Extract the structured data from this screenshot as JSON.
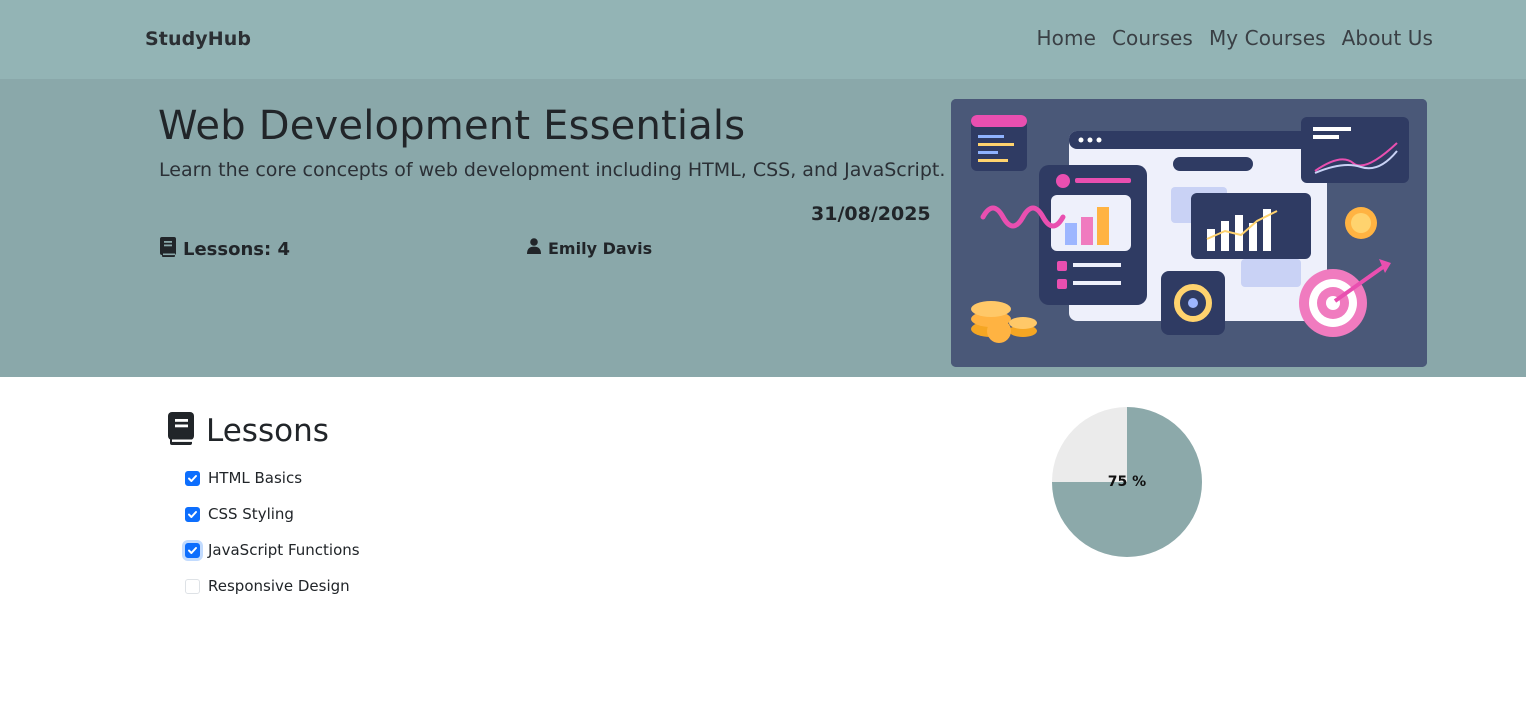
{
  "nav": {
    "brand": "StudyHub",
    "links": [
      "Home",
      "Courses",
      "My Courses",
      "About Us"
    ]
  },
  "course": {
    "title": "Web Development Essentials",
    "description": "Learn the core concepts of web development including HTML, CSS, and JavaScript.",
    "date": "31/08/2025",
    "lessons_label": "Lessons: 4",
    "author": "Emily Davis"
  },
  "lessons": {
    "heading": "Lessons",
    "items": [
      {
        "label": "HTML Basics",
        "checked": true
      },
      {
        "label": "CSS Styling",
        "checked": true
      },
      {
        "label": "JavaScript Functions",
        "checked": true
      },
      {
        "label": "Responsive Design",
        "checked": false
      }
    ]
  },
  "progress": {
    "percent": 75,
    "label": "75 %"
  },
  "colors": {
    "navbar": "#93b4b5",
    "hero": "#8aa8aa",
    "pie_fill": "#8ca9aa",
    "pie_rest": "#ebebeb",
    "checkbox": "#0d6efd"
  },
  "icons": {
    "lessons_meta": "book-icon",
    "author_meta": "user-icon",
    "lessons_heading": "book-icon"
  }
}
